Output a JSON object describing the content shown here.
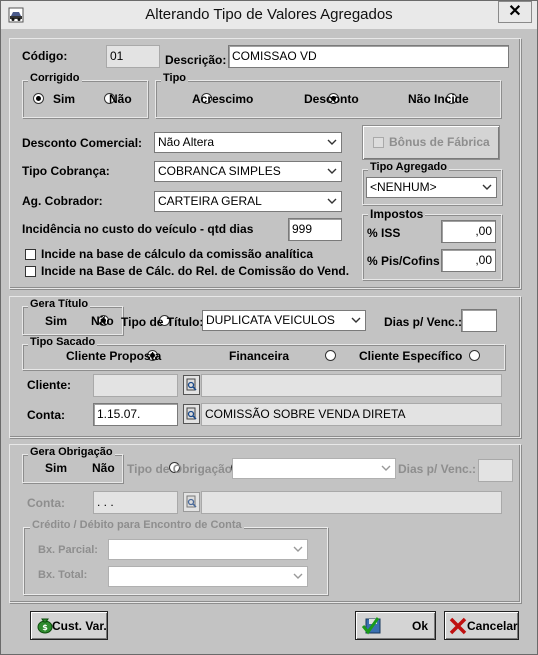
{
  "window": {
    "title": "Alterando Tipo de Valores Agregados",
    "close_label": "✕"
  },
  "header": {
    "codigo_label": "Código:",
    "codigo_value": "01",
    "descricao_label": "Descrição:",
    "descricao_value": "COMISSAO VD"
  },
  "corrigido": {
    "title": "Corrigido",
    "options": [
      {
        "label": "Sim",
        "selected": true
      },
      {
        "label": "Não",
        "selected": false
      }
    ]
  },
  "tipo": {
    "title": "Tipo",
    "options": [
      {
        "label": "Acrescimo",
        "selected": false
      },
      {
        "label": "Desconto",
        "selected": true
      },
      {
        "label": "Não Incide",
        "selected": false
      }
    ]
  },
  "desconto_comercial": {
    "label": "Desconto Comercial:",
    "value": "Não Altera"
  },
  "tipo_cobranca": {
    "label": "Tipo Cobrança:",
    "value": "COBRANCA SIMPLES"
  },
  "ag_cobrador": {
    "label": "Ag. Cobrador:",
    "value": "CARTEIRA GERAL"
  },
  "incidencia": {
    "label": "Incidência no custo do veículo - qtd dias",
    "value": "999"
  },
  "checks": [
    {
      "label": "Incide na base de cálculo da comissão analítica",
      "checked": false
    },
    {
      "label": "Incide na Base de Cálc. do Rel. de Comissão do Vend.",
      "checked": false
    }
  ],
  "bonus_fabrica": {
    "label": "Bônus de Fábrica",
    "checked": false
  },
  "tipo_agregado": {
    "title": "Tipo Agregado",
    "value": "<NENHUM>"
  },
  "impostos": {
    "title": "Impostos",
    "iss_label": "% ISS",
    "iss_value": ",00",
    "piscofins_label": "% Pis/Cofins",
    "piscofins_value": ",00"
  },
  "gera_titulo": {
    "title": "Gera Título",
    "options": [
      {
        "label": "Sim",
        "selected": true
      },
      {
        "label": "Não",
        "selected": false
      }
    ]
  },
  "tipo_titulo": {
    "label": "Tipo de Título:",
    "value": "DUPLICATA VEICULOS"
  },
  "dias_venc": {
    "label": "Dias p/ Venc.:",
    "value": ""
  },
  "tipo_sacado": {
    "title": "Tipo Sacado",
    "options": [
      {
        "label": "Cliente Proposta",
        "selected": true
      },
      {
        "label": "Financeira",
        "selected": false
      },
      {
        "label": "Cliente Específico",
        "selected": false
      }
    ]
  },
  "cliente": {
    "label": "Cliente:",
    "code": "",
    "name": ""
  },
  "conta": {
    "label": "Conta:",
    "code": "1.15.07.",
    "name": "COMISSÃO SOBRE VENDA DIRETA"
  },
  "gera_obrigacao": {
    "title": "Gera Obrigação",
    "options": [
      {
        "label": "Sim",
        "selected": false
      },
      {
        "label": "Não",
        "selected": true
      }
    ]
  },
  "tipo_obrigacao": {
    "label": "Tipo de Obrigação:",
    "value": ""
  },
  "dias_venc2": {
    "label": "Dias p/ Venc.:",
    "value": ""
  },
  "conta2": {
    "label": "Conta:",
    "code": ". . .",
    "name": ""
  },
  "credito_debito": {
    "title": "Crédito / Débito para Encontro de Conta",
    "parcial_label": "Bx. Parcial:",
    "total_label": "Bx. Total:"
  },
  "buttons": {
    "cust_var": "Cust. Var.",
    "ok": "Ok",
    "cancelar": "Cancelar"
  }
}
